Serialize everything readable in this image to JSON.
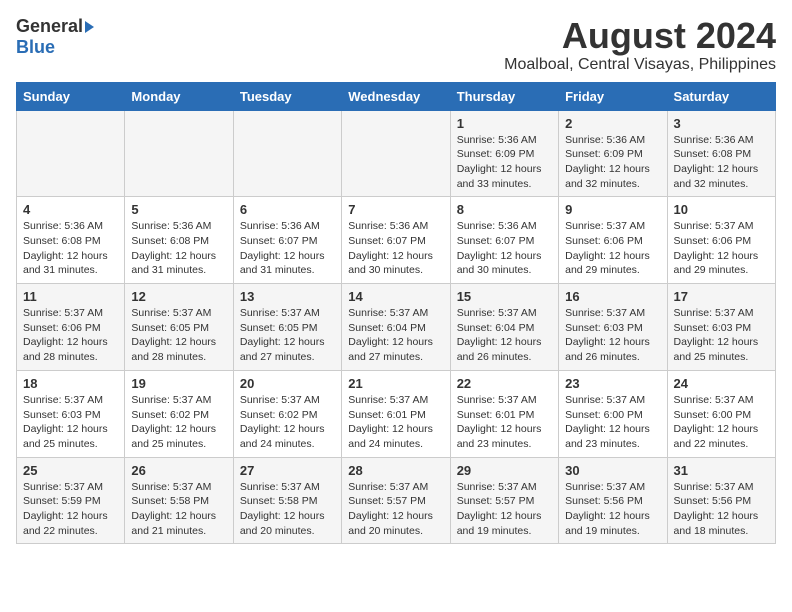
{
  "logo": {
    "general": "General",
    "blue": "Blue"
  },
  "title": "August 2024",
  "subtitle": "Moalboal, Central Visayas, Philippines",
  "days_of_week": [
    "Sunday",
    "Monday",
    "Tuesday",
    "Wednesday",
    "Thursday",
    "Friday",
    "Saturday"
  ],
  "weeks": [
    [
      {
        "day": "",
        "text": ""
      },
      {
        "day": "",
        "text": ""
      },
      {
        "day": "",
        "text": ""
      },
      {
        "day": "",
        "text": ""
      },
      {
        "day": "1",
        "text": "Sunrise: 5:36 AM\nSunset: 6:09 PM\nDaylight: 12 hours\nand 33 minutes."
      },
      {
        "day": "2",
        "text": "Sunrise: 5:36 AM\nSunset: 6:09 PM\nDaylight: 12 hours\nand 32 minutes."
      },
      {
        "day": "3",
        "text": "Sunrise: 5:36 AM\nSunset: 6:08 PM\nDaylight: 12 hours\nand 32 minutes."
      }
    ],
    [
      {
        "day": "4",
        "text": "Sunrise: 5:36 AM\nSunset: 6:08 PM\nDaylight: 12 hours\nand 31 minutes."
      },
      {
        "day": "5",
        "text": "Sunrise: 5:36 AM\nSunset: 6:08 PM\nDaylight: 12 hours\nand 31 minutes."
      },
      {
        "day": "6",
        "text": "Sunrise: 5:36 AM\nSunset: 6:07 PM\nDaylight: 12 hours\nand 31 minutes."
      },
      {
        "day": "7",
        "text": "Sunrise: 5:36 AM\nSunset: 6:07 PM\nDaylight: 12 hours\nand 30 minutes."
      },
      {
        "day": "8",
        "text": "Sunrise: 5:36 AM\nSunset: 6:07 PM\nDaylight: 12 hours\nand 30 minutes."
      },
      {
        "day": "9",
        "text": "Sunrise: 5:37 AM\nSunset: 6:06 PM\nDaylight: 12 hours\nand 29 minutes."
      },
      {
        "day": "10",
        "text": "Sunrise: 5:37 AM\nSunset: 6:06 PM\nDaylight: 12 hours\nand 29 minutes."
      }
    ],
    [
      {
        "day": "11",
        "text": "Sunrise: 5:37 AM\nSunset: 6:06 PM\nDaylight: 12 hours\nand 28 minutes."
      },
      {
        "day": "12",
        "text": "Sunrise: 5:37 AM\nSunset: 6:05 PM\nDaylight: 12 hours\nand 28 minutes."
      },
      {
        "day": "13",
        "text": "Sunrise: 5:37 AM\nSunset: 6:05 PM\nDaylight: 12 hours\nand 27 minutes."
      },
      {
        "day": "14",
        "text": "Sunrise: 5:37 AM\nSunset: 6:04 PM\nDaylight: 12 hours\nand 27 minutes."
      },
      {
        "day": "15",
        "text": "Sunrise: 5:37 AM\nSunset: 6:04 PM\nDaylight: 12 hours\nand 26 minutes."
      },
      {
        "day": "16",
        "text": "Sunrise: 5:37 AM\nSunset: 6:03 PM\nDaylight: 12 hours\nand 26 minutes."
      },
      {
        "day": "17",
        "text": "Sunrise: 5:37 AM\nSunset: 6:03 PM\nDaylight: 12 hours\nand 25 minutes."
      }
    ],
    [
      {
        "day": "18",
        "text": "Sunrise: 5:37 AM\nSunset: 6:03 PM\nDaylight: 12 hours\nand 25 minutes."
      },
      {
        "day": "19",
        "text": "Sunrise: 5:37 AM\nSunset: 6:02 PM\nDaylight: 12 hours\nand 25 minutes."
      },
      {
        "day": "20",
        "text": "Sunrise: 5:37 AM\nSunset: 6:02 PM\nDaylight: 12 hours\nand 24 minutes."
      },
      {
        "day": "21",
        "text": "Sunrise: 5:37 AM\nSunset: 6:01 PM\nDaylight: 12 hours\nand 24 minutes."
      },
      {
        "day": "22",
        "text": "Sunrise: 5:37 AM\nSunset: 6:01 PM\nDaylight: 12 hours\nand 23 minutes."
      },
      {
        "day": "23",
        "text": "Sunrise: 5:37 AM\nSunset: 6:00 PM\nDaylight: 12 hours\nand 23 minutes."
      },
      {
        "day": "24",
        "text": "Sunrise: 5:37 AM\nSunset: 6:00 PM\nDaylight: 12 hours\nand 22 minutes."
      }
    ],
    [
      {
        "day": "25",
        "text": "Sunrise: 5:37 AM\nSunset: 5:59 PM\nDaylight: 12 hours\nand 22 minutes."
      },
      {
        "day": "26",
        "text": "Sunrise: 5:37 AM\nSunset: 5:58 PM\nDaylight: 12 hours\nand 21 minutes."
      },
      {
        "day": "27",
        "text": "Sunrise: 5:37 AM\nSunset: 5:58 PM\nDaylight: 12 hours\nand 20 minutes."
      },
      {
        "day": "28",
        "text": "Sunrise: 5:37 AM\nSunset: 5:57 PM\nDaylight: 12 hours\nand 20 minutes."
      },
      {
        "day": "29",
        "text": "Sunrise: 5:37 AM\nSunset: 5:57 PM\nDaylight: 12 hours\nand 19 minutes."
      },
      {
        "day": "30",
        "text": "Sunrise: 5:37 AM\nSunset: 5:56 PM\nDaylight: 12 hours\nand 19 minutes."
      },
      {
        "day": "31",
        "text": "Sunrise: 5:37 AM\nSunset: 5:56 PM\nDaylight: 12 hours\nand 18 minutes."
      }
    ]
  ]
}
